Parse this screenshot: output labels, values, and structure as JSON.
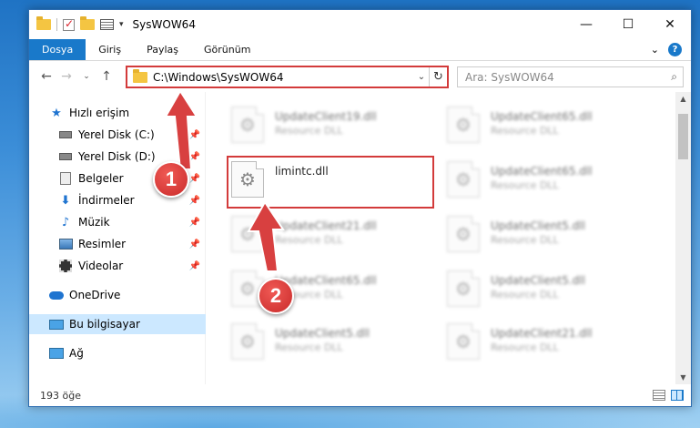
{
  "window": {
    "title": "SysWOW64"
  },
  "ribbon": {
    "tabs": [
      "Dosya",
      "Giriş",
      "Paylaş",
      "Görünüm"
    ]
  },
  "address": {
    "path": "C:\\Windows\\SysWOW64",
    "search_placeholder": "Ara: SysWOW64"
  },
  "nav": {
    "quick_access": "Hızlı erişim",
    "items": [
      "Yerel Disk (C:)",
      "Yerel Disk (D:)",
      "Belgeler",
      "İndirmeler",
      "Müzik",
      "Resimler",
      "Videolar"
    ],
    "onedrive": "OneDrive",
    "this_pc": "Bu bilgisayar",
    "network": "Ağ"
  },
  "files": {
    "col1": [
      {
        "name": "UpdateClient19.dll",
        "type": "Resource DLL"
      },
      {
        "name": "limintc.dll",
        "type": ""
      },
      {
        "name": "UpdateClient21.dll",
        "type": "Resource DLL"
      },
      {
        "name": "UpdateClient65.dll",
        "type": "Resource DLL"
      },
      {
        "name": "UpdateClient5.dll",
        "type": "Resource DLL"
      }
    ],
    "col2": [
      {
        "name": "UpdateClient65.dll",
        "type": "Resource DLL"
      },
      {
        "name": "UpdateClient65.dll",
        "type": "Resource DLL"
      },
      {
        "name": "UpdateClient5.dll",
        "type": "Resource DLL"
      },
      {
        "name": "UpdateClient5.dll",
        "type": "Resource DLL"
      },
      {
        "name": "UpdateClient21.dll",
        "type": "Resource DLL"
      }
    ]
  },
  "status": {
    "count": "193 öğe"
  },
  "callouts": [
    "1",
    "2"
  ],
  "colors": {
    "accent": "#1979ca",
    "highlight": "#d33b3b",
    "selection": "#cce8ff"
  }
}
